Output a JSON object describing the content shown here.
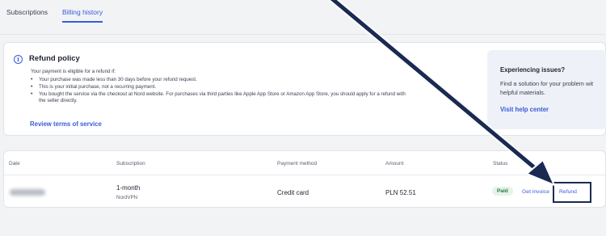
{
  "tabs": [
    {
      "label": "Subscriptions",
      "active": false
    },
    {
      "label": "Billing history",
      "active": true
    }
  ],
  "policy": {
    "title": "Refund policy",
    "intro": "Your payment is eligible for a refund if:",
    "items": [
      "Your purchase was made less than 30 days before your refund request.",
      "This is your initial purchase, not a recurring payment.",
      "You bought the service via the checkout at Nord website. For purchases via third parties like Apple App Store or Amazon App Store, you should apply for a refund with",
      "the seller directly."
    ],
    "link": "Review terms of service"
  },
  "issues": {
    "title": "Experiencing issues?",
    "text_line1": "Find a solution for your problem wit",
    "text_line2": "helpful materials.",
    "link": "Visit help center"
  },
  "table": {
    "headers": {
      "date": "Date",
      "subscription": "Subscription",
      "payment": "Payment method",
      "amount": "Amount",
      "status": "Status"
    },
    "row": {
      "subscription": "1-month",
      "product": "NordVPN",
      "payment": "Credit card",
      "amount": "PLN 52.51",
      "status": "Paid",
      "invoice_link": "Get invoice",
      "refund_link": "Refund"
    }
  },
  "colors": {
    "accent": "#3a5bd9",
    "annotation": "#1a2a52",
    "paid_bg": "#e4f4e8",
    "paid_text": "#2a7a44"
  }
}
